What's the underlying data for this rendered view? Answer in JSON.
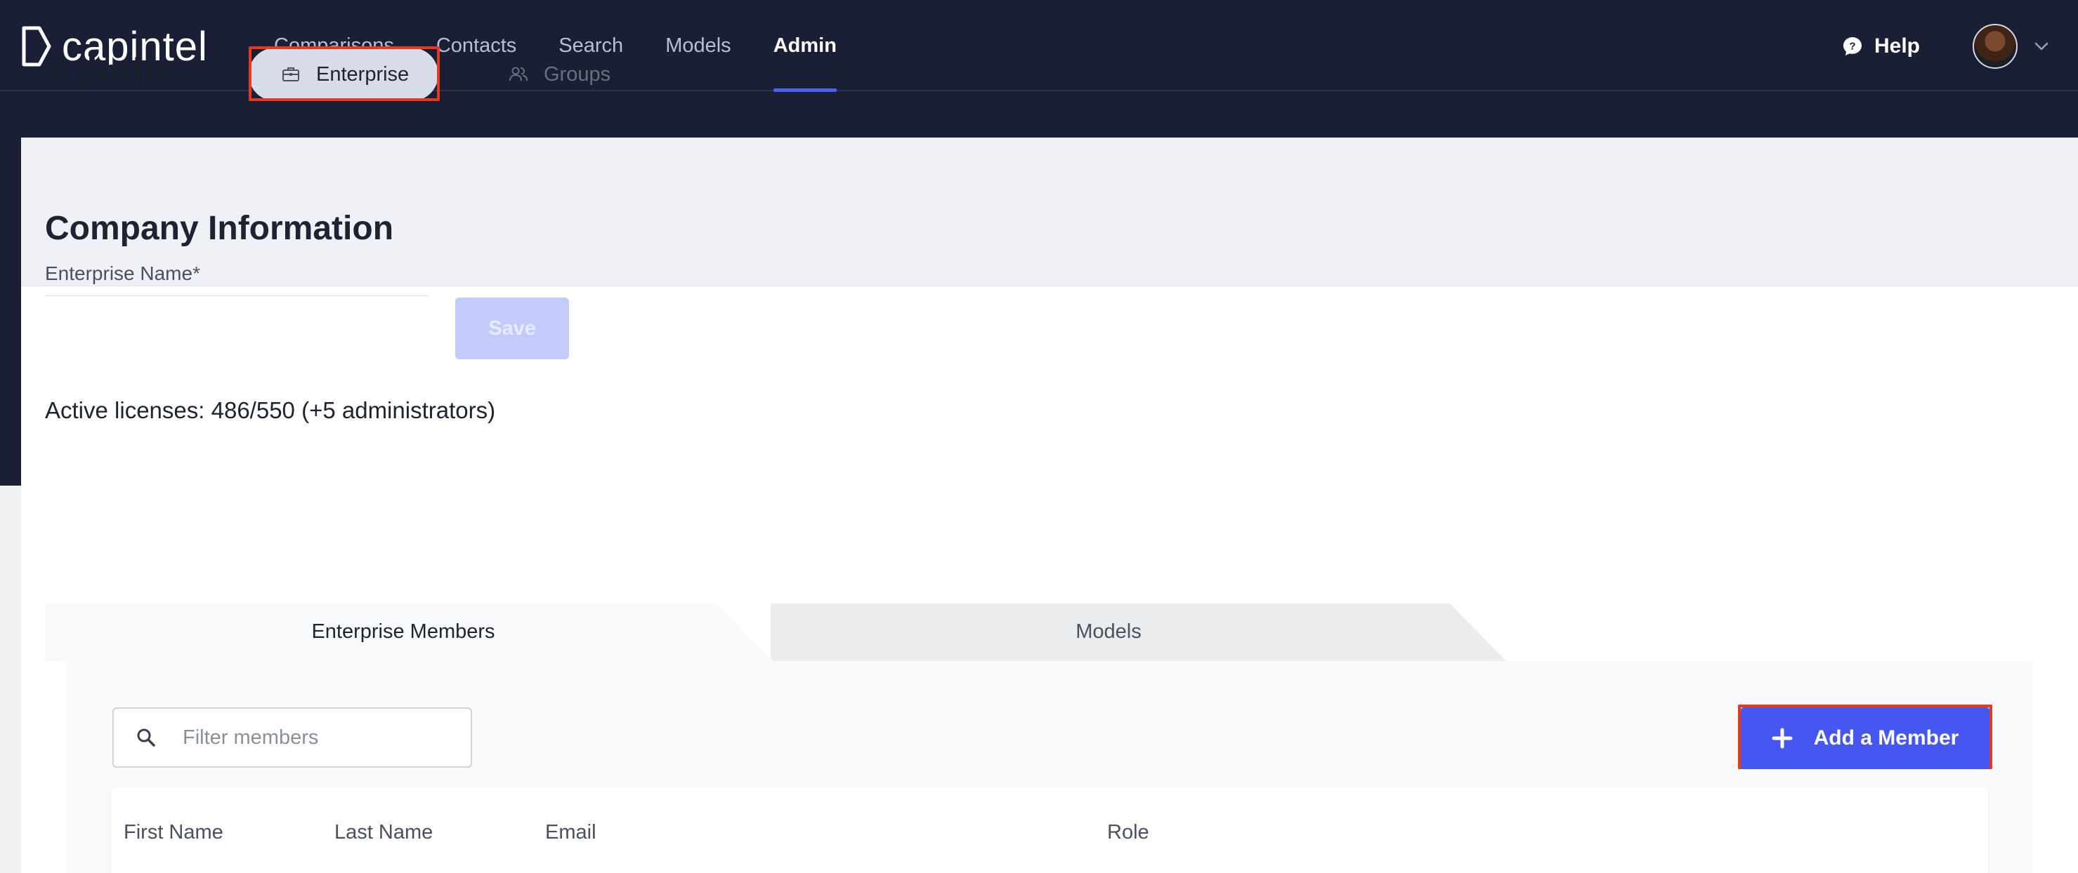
{
  "brand": {
    "name": "capintel"
  },
  "nav": {
    "items": [
      {
        "label": "Comparisons",
        "active": false
      },
      {
        "label": "Contacts",
        "active": false
      },
      {
        "label": "Search",
        "active": false
      },
      {
        "label": "Models",
        "active": false
      },
      {
        "label": "Admin",
        "active": true
      }
    ],
    "help_label": "Help"
  },
  "page": {
    "title": "Admin",
    "tabs": [
      {
        "label": "Enterprise",
        "icon": "briefcase-icon",
        "selected": true
      },
      {
        "label": "Groups",
        "icon": "users-icon",
        "selected": false
      }
    ]
  },
  "company": {
    "section_title": "Company Information",
    "name_label": "Enterprise Name*",
    "name_value": "",
    "save_label": "Save"
  },
  "licenses": {
    "prefix": "Active licenses:",
    "count": "486/550",
    "suffix": "(+5 administrators)"
  },
  "member_tabs": [
    {
      "label": "Enterprise Members",
      "selected": true
    },
    {
      "label": "Models",
      "selected": false
    }
  ],
  "members": {
    "filter_placeholder": "Filter members",
    "add_label": "Add a Member",
    "columns": [
      "First Name",
      "Last Name",
      "Email",
      "Role"
    ]
  },
  "colors": {
    "nav_bg": "#1a1f36",
    "accent": "#4557f0",
    "highlight_outline": "#e53a1f",
    "save_disabled": "#c3cbfb"
  }
}
